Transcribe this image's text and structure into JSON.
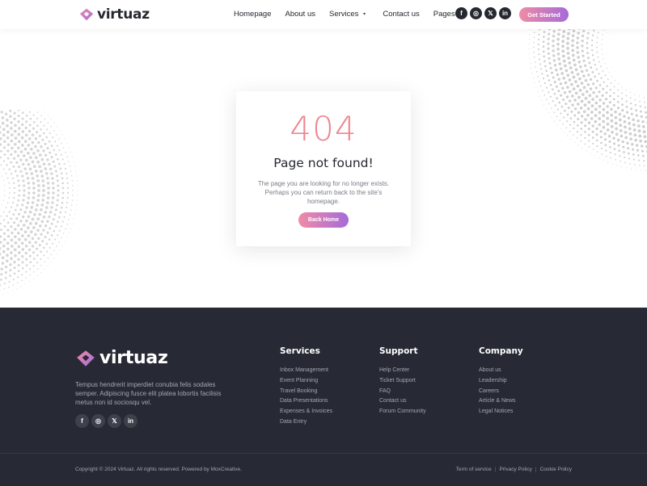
{
  "brand": {
    "name": "virtuaz"
  },
  "colors": {
    "accent_start": "#f08ba6",
    "accent_end": "#a66ad9",
    "error_code": "#f0858f",
    "footer_bg": "#272a35"
  },
  "nav": {
    "items": [
      {
        "label": "Homepage",
        "dropdown": false
      },
      {
        "label": "About us",
        "dropdown": false
      },
      {
        "label": "Services",
        "dropdown": true
      },
      {
        "label": "Contact us",
        "dropdown": false
      },
      {
        "label": "Pages",
        "dropdown": true
      }
    ],
    "socials": [
      {
        "icon": "facebook-icon",
        "glyph": "f"
      },
      {
        "icon": "instagram-icon",
        "glyph": "◎"
      },
      {
        "icon": "x-icon",
        "glyph": "𝕏"
      },
      {
        "icon": "linkedin-icon",
        "glyph": "in"
      }
    ],
    "cta_label": "Get Started"
  },
  "error": {
    "code": "404",
    "title": "Page not found!",
    "description": "The page you are looking for no longer exists. Perhaps you can return back to the site's homepage.",
    "button_label": "Back Home"
  },
  "footer": {
    "about": "Tempus hendrerit imperdiet conubia felis sodales semper. Adipiscing fusce elit platea lobortis facilisis metus non id sociosqu vel.",
    "columns": [
      {
        "title": "Services",
        "links": [
          "Inbox Management",
          "Event Planning",
          "Travel Booking",
          "Data Presentations",
          "Expenses & Invoices",
          "Data Entry"
        ]
      },
      {
        "title": "Support",
        "links": [
          "Help Center",
          "Ticket Support",
          "FAQ",
          "Contact us",
          "Forum Community"
        ]
      },
      {
        "title": "Company",
        "links": [
          "About us",
          "Leadership",
          "Careers",
          "Article & News",
          "Legal Notices"
        ]
      }
    ],
    "copyright": "Copyright © 2024 Virtuaz. All rights reserved. Powered by MoxCreative.",
    "legal_links": [
      "Term of service",
      "Privacy Policy",
      "Cookie Policy"
    ]
  }
}
